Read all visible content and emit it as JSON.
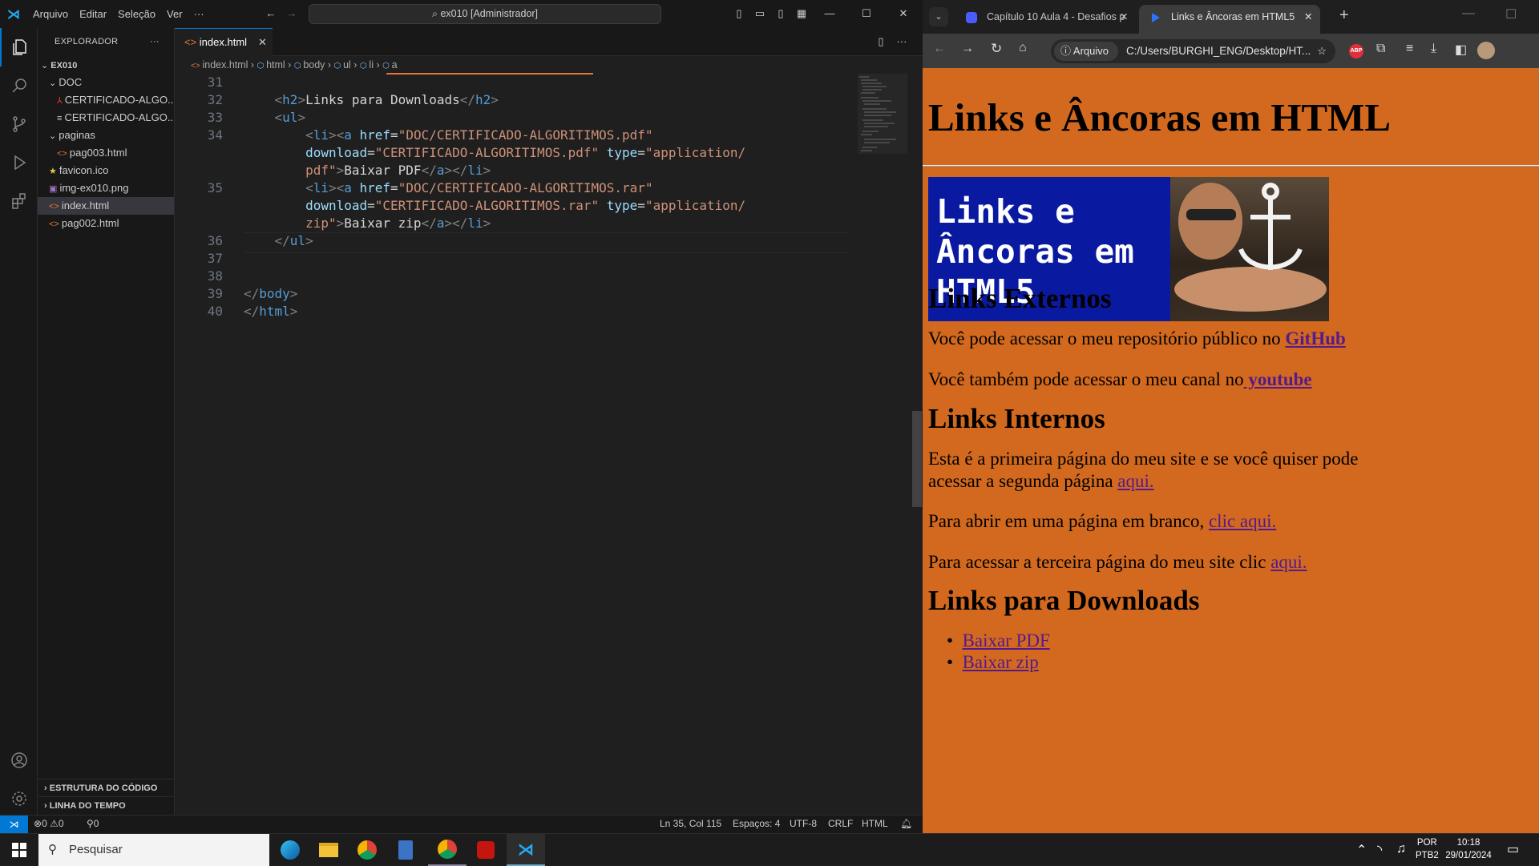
{
  "vscode": {
    "menu": [
      "Arquivo",
      "Editar",
      "Seleção",
      "Ver",
      "···"
    ],
    "command_center": "ex010 [Administrador]",
    "explorer_title": "EXPLORADOR",
    "explorer_more": "···",
    "tree": [
      {
        "label": "EX010",
        "level": 0,
        "type": "folder-open"
      },
      {
        "label": "DOC",
        "level": 1,
        "type": "folder-open"
      },
      {
        "label": "CERTIFICADO-ALGO...",
        "level": 2,
        "type": "pdf"
      },
      {
        "label": "CERTIFICADO-ALGO...",
        "level": 2,
        "type": "text"
      },
      {
        "label": "paginas",
        "level": 1,
        "type": "folder-open"
      },
      {
        "label": "pag003.html",
        "level": 2,
        "type": "html"
      },
      {
        "label": "favicon.ico",
        "level": 1,
        "type": "star"
      },
      {
        "label": "img-ex010.png",
        "level": 1,
        "type": "image"
      },
      {
        "label": "index.html",
        "level": 1,
        "type": "html",
        "selected": true
      },
      {
        "label": "pag002.html",
        "level": 1,
        "type": "html"
      }
    ],
    "outline_label": "ESTRUTURA DO CÓDIGO",
    "timeline_label": "LINHA DO TEMPO",
    "tab_label": "index.html",
    "breadcrumb": [
      "index.html",
      "html",
      "body",
      "ul",
      "li",
      "a"
    ],
    "line_numbers": [
      "31",
      "32",
      "33",
      "34",
      "",
      "",
      "35",
      "",
      "",
      "36",
      "37",
      "38",
      "39",
      "40"
    ],
    "status": {
      "errors": "0",
      "warnings": "0",
      "ports": "0",
      "position": "Ln 35, Col 115",
      "spaces": "Espaços: 4",
      "encoding": "UTF-8",
      "eol": "CRLF",
      "language": "HTML"
    }
  },
  "chrome": {
    "tabs": [
      {
        "label": "Capítulo 10 Aula 4 - Desafios p"
      },
      {
        "label": "Links e Âncoras em HTML5"
      }
    ],
    "address_chip": "Arquivo",
    "url": "C:/Users/BURGHI_ENG/Desktop/HT...",
    "page": {
      "h1": "Links e Âncoras em HTML",
      "banner_text": [
        "Links e",
        "Âncoras em",
        "HTML5"
      ],
      "h2_external": "Links Externos",
      "p1_text": "Você pode acessar o meu repositório público no ",
      "p1_link": "GitHub",
      "p2_text": "Você também pode acessar o meu canal no",
      "p2_link": " youtube",
      "h2_internal": "Links Internos",
      "p3_text_a": "Esta é a primeira página do meu site e se você quiser pode",
      "p3_text_b": "acessar a segunda página ",
      "p3_link": "aqui.",
      "p4_text": "Para abrir em uma página em branco, ",
      "p4_link": "clic aqui.",
      "p5_text": "Para acessar a terceira página do meu site clic ",
      "p5_link": "aqui.",
      "h2_downloads": "Links para Downloads",
      "downloads": [
        "Baixar PDF",
        "Baixar zip"
      ]
    }
  },
  "taskbar": {
    "search_placeholder": "Pesquisar",
    "lang": "POR",
    "layout": "PTB2",
    "time": "10:18",
    "date": "29/01/2024"
  }
}
